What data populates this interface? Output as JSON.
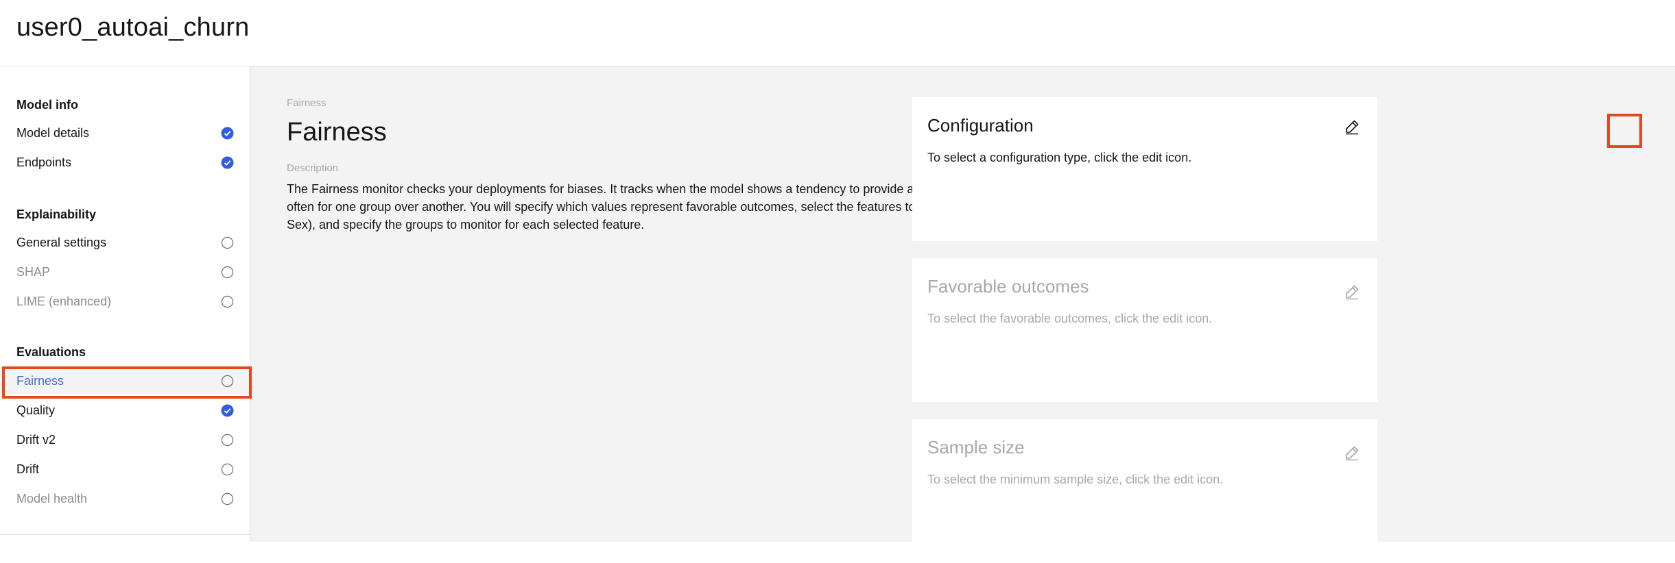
{
  "header": {
    "title": "user0_autoai_churn"
  },
  "sidebar": {
    "sections": [
      {
        "heading": "Model info"
      },
      {
        "heading": "Explainability"
      },
      {
        "heading": "Evaluations"
      }
    ],
    "items": {
      "model_details": {
        "label": "Model details",
        "status": "complete"
      },
      "endpoints": {
        "label": "Endpoints",
        "status": "complete"
      },
      "general_settings": {
        "label": "General settings",
        "status": "incomplete"
      },
      "shap": {
        "label": "SHAP",
        "status": "incomplete",
        "disabled": true
      },
      "lime": {
        "label": "LIME (enhanced)",
        "status": "incomplete",
        "disabled": true
      },
      "fairness": {
        "label": "Fairness",
        "status": "incomplete",
        "selected": true
      },
      "quality": {
        "label": "Quality",
        "status": "complete"
      },
      "drift_v2": {
        "label": "Drift v2",
        "status": "incomplete"
      },
      "drift": {
        "label": "Drift",
        "status": "incomplete"
      },
      "model_health": {
        "label": "Model health",
        "status": "incomplete",
        "disabled": true
      }
    }
  },
  "main": {
    "breadcrumb": "Fairness",
    "title": "Fairness",
    "description_label": "Description",
    "description": "The Fairness monitor checks your deployments for biases. It tracks when the model shows a tendency to provide a favorable (preferable) outcome more often for one group over another. You will specify which values represent favorable outcomes, select the features to monitor for bias (for example, Age or Sex), and specify the groups to monitor for each selected feature."
  },
  "cards": {
    "configuration": {
      "title": "Configuration",
      "text": "To select a configuration type, click the edit icon."
    },
    "favorable_outcomes": {
      "title": "Favorable outcomes",
      "text": "To select the favorable outcomes, click the edit icon."
    },
    "sample_size": {
      "title": "Sample size",
      "text": "To select the minimum sample size, click the edit icon."
    }
  },
  "colors": {
    "accent": "#3d6bd6",
    "check_fill": "#0f62fe",
    "highlight": "#e8471c"
  }
}
